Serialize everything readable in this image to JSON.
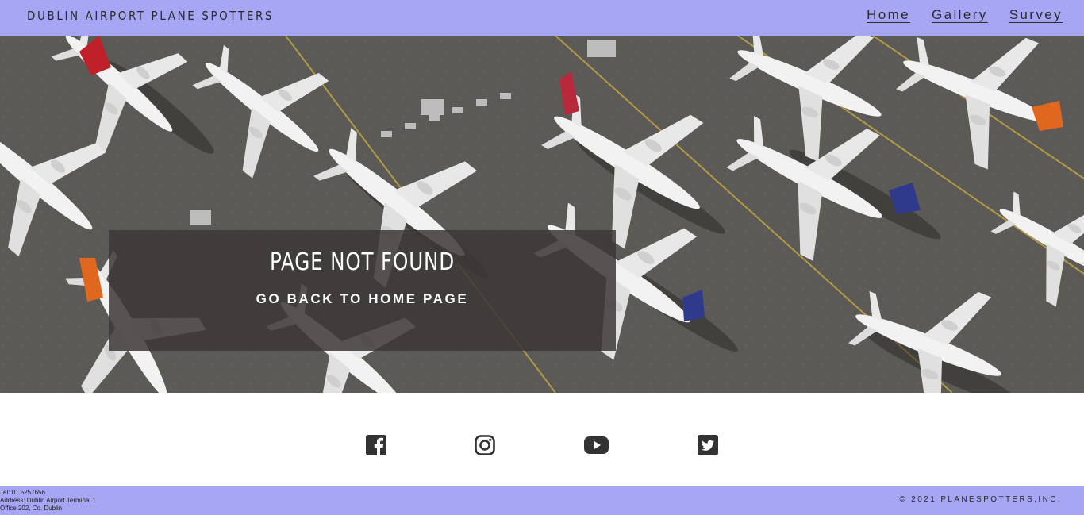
{
  "header": {
    "brand": "DUBLIN AIRPORT PLANE SPOTTERS",
    "nav": [
      {
        "label": "Home"
      },
      {
        "label": "Gallery"
      },
      {
        "label": "Survey"
      }
    ],
    "background_color": "#a6a6f5"
  },
  "hero": {
    "title": "PAGE NOT FOUND",
    "link_label": "GO BACK TO HOME PAGE"
  },
  "social": {
    "icons": [
      "facebook-icon",
      "instagram-icon",
      "youtube-icon",
      "twitter-icon"
    ],
    "icon_color": "#333333"
  },
  "footer": {
    "tel": "Tel: 01 5257656",
    "address_line1": "Address: Dublin Airport Terminal 1",
    "address_line2": "Office 202, Co. Dublin",
    "copyright": "© 2021 PLANESPOTTERS,INC.",
    "background_color": "#a6a6f5"
  }
}
